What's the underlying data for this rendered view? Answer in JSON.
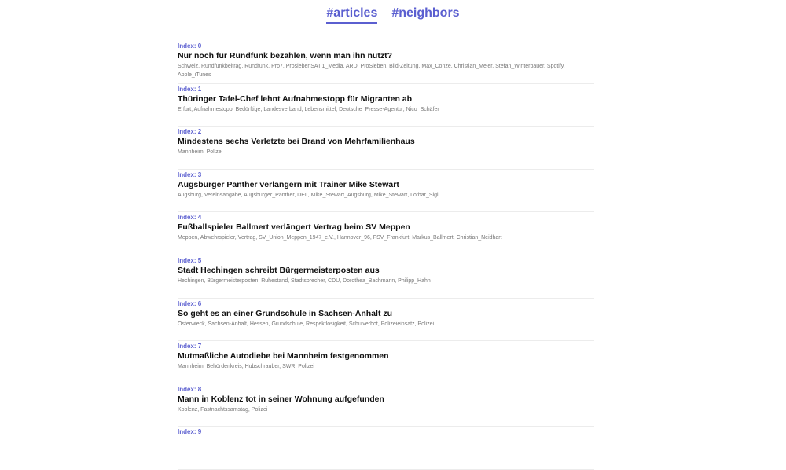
{
  "nav": {
    "articles": "#articles",
    "neighbors": "#neighbors"
  },
  "articles": [
    {
      "index": "Index: 0",
      "title": "Nur noch für Rundfunk bezahlen, wenn man ihn nutzt?",
      "tags": "Schweiz, Rundfunkbeitrag, Rundfunk, Pro7, ProsiebenSAT.1_Media, ARD, ProSieben, Bild-Zeitung, Max_Conze, Christian_Meier, Stefan_Winterbauer, Spotify, Apple_iTunes"
    },
    {
      "index": "Index: 1",
      "title": "Thüringer Tafel-Chef lehnt Aufnahmestopp für Migranten ab",
      "tags": "Erfurt, Aufnahmestopp, Bedürftige, Landesverband, Lebensmittel, Deutsche_Presse-Agentur, Nico_Schäfer"
    },
    {
      "index": "Index: 2",
      "title": "Mindestens sechs Verletzte bei Brand von Mehrfamilienhaus",
      "tags": "Mannheim, Polizei"
    },
    {
      "index": "Index: 3",
      "title": "Augsburger Panther verlängern mit Trainer Mike Stewart",
      "tags": "Augsburg, Vereinsangabe, Augsburger_Panther, DEL, Mike_Stewart_Augsburg, Mike_Stewart, Lothar_Sigl"
    },
    {
      "index": "Index: 4",
      "title": "Fußballspieler Ballmert verlängert Vertrag beim SV Meppen",
      "tags": "Meppen, Abwehrspieler, Vertrag, SV_Union_Meppen_1947_e.V., Hannover_96, FSV_Frankfurt, Markus_Ballmert, Christian_Neidhart"
    },
    {
      "index": "Index: 5",
      "title": "Stadt Hechingen schreibt Bürgermeisterposten aus",
      "tags": "Hechingen, Bürgermeisterposten, Ruhestand, Stadtsprecher, CDU, Dorothea_Bachmann, Philipp_Hahn"
    },
    {
      "index": "Index: 6",
      "title": "So geht es an einer Grundschule in Sachsen-Anhalt zu",
      "tags": "Osterwieck, Sachsen-Anhalt, Hessen, Grundschule, Respektlosigkeit, Schulverbot, Polizeieinsatz, Polizei"
    },
    {
      "index": "Index: 7",
      "title": "Mutmaßliche Autodiebe bei Mannheim festgenommen",
      "tags": "Mannheim, Behördenkreis, Hubschrauber, SWR, Polizei"
    },
    {
      "index": "Index: 8",
      "title": "Mann in Koblenz tot in seiner Wohnung aufgefunden",
      "tags": "Koblenz, Fastnachtssamstag, Polizei"
    },
    {
      "index": "Index: 9",
      "title": "",
      "tags": ""
    }
  ]
}
